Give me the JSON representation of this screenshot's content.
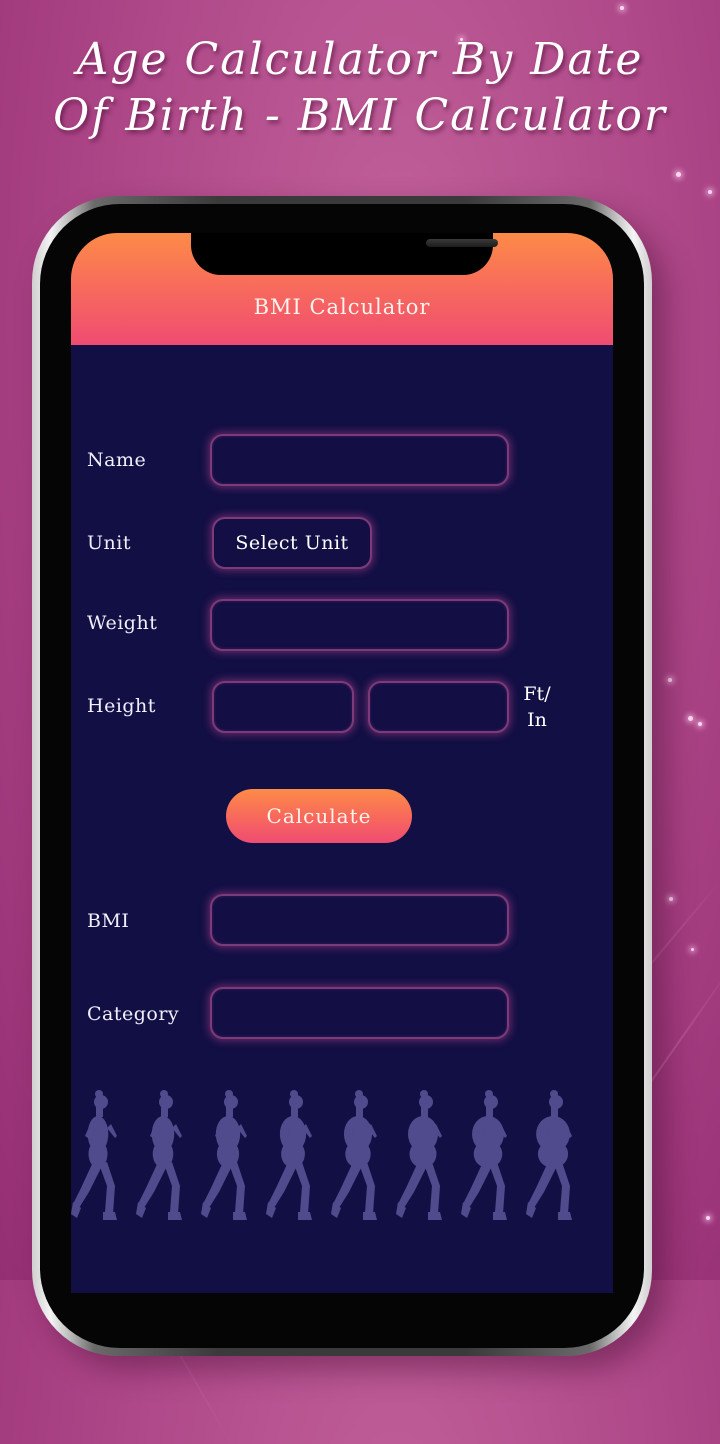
{
  "promo": {
    "title_line1": "Age Calculator By Date",
    "title_line2": "Of Birth - BMI Calculator"
  },
  "app": {
    "header_title": "BMI Calculator",
    "accent_gradient": [
      "#fd8b47",
      "#ef4c71"
    ],
    "background_color": "#120f44",
    "field_glow_color": "#c8469a"
  },
  "form": {
    "name": {
      "label": "Name",
      "value": ""
    },
    "unit": {
      "label": "Unit",
      "button_label": "Select Unit"
    },
    "weight": {
      "label": "Weight",
      "value": ""
    },
    "height": {
      "label": "Height",
      "feet_value": "",
      "inches_value": "",
      "suffix_line1": "Ft/",
      "suffix_line2": "In"
    },
    "calculate_label": "Calculate",
    "bmi": {
      "label": "BMI",
      "value": ""
    },
    "category": {
      "label": "Category",
      "value": ""
    }
  },
  "illustration": {
    "description": "row of jogging woman silhouettes from slim to overweight",
    "figure_count": 8,
    "figure_color": "#4f4b8c"
  }
}
